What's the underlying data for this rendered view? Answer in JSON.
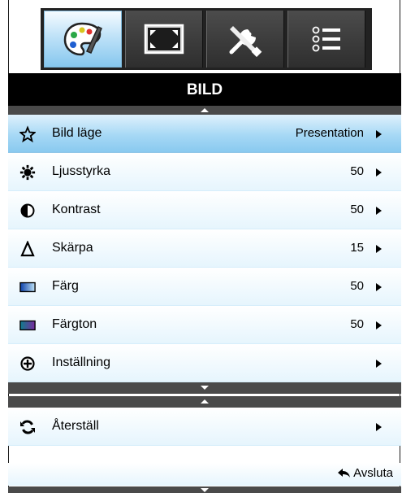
{
  "tabs": [
    {
      "name": "palette-icon",
      "active": true
    },
    {
      "name": "screen-resize-icon",
      "active": false
    },
    {
      "name": "tools-icon",
      "active": false
    },
    {
      "name": "options-list-icon",
      "active": false
    }
  ],
  "menu": {
    "title": "BILD",
    "items": [
      {
        "label": "Bild läge",
        "value": "Presentation",
        "icon": "star-icon"
      },
      {
        "label": "Ljusstyrka",
        "value": "50",
        "icon": "brightness-icon"
      },
      {
        "label": "Kontrast",
        "value": "50",
        "icon": "contrast-icon"
      },
      {
        "label": "Skärpa",
        "value": "15",
        "icon": "sharpness-icon"
      },
      {
        "label": "Färg",
        "value": "50",
        "icon": "color-icon"
      },
      {
        "label": "Färgton",
        "value": "50",
        "icon": "tint-icon"
      },
      {
        "label": "Inställning",
        "value": "",
        "icon": "settings-plus-icon"
      }
    ],
    "reset": {
      "label": "Återställ",
      "icon": "reset-icon"
    },
    "exit_label": "Avsluta"
  },
  "colors": {
    "accent": "#89c9ef",
    "header": "#000000",
    "row": "#e6f5fd"
  }
}
